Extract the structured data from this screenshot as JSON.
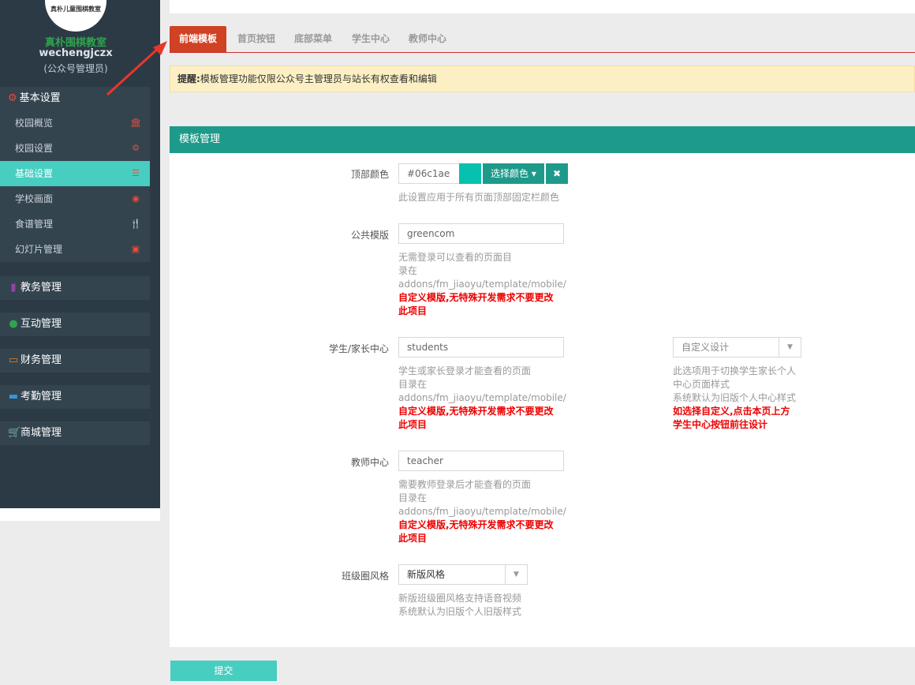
{
  "sidebar": {
    "logo_text": "真朴儿童围棋教室",
    "school_name": "真朴围棋教室",
    "user_name": "wechengjczx",
    "user_role": "(公众号管理员)",
    "basic_settings": {
      "title": "基本设置",
      "items": [
        {
          "label": "校园概览",
          "icon": "bank-icon"
        },
        {
          "label": "校园设置",
          "icon": "gear-icon"
        },
        {
          "label": "基础设置",
          "icon": "list-icon",
          "active": true
        },
        {
          "label": "学校画面",
          "icon": "eye-icon"
        },
        {
          "label": "食谱管理",
          "icon": "cutlery-icon"
        },
        {
          "label": "幻灯片管理",
          "icon": "picture-icon"
        }
      ]
    },
    "groups": [
      {
        "label": "教务管理",
        "icon": "book-icon",
        "color": "#8e44ad"
      },
      {
        "label": "互动管理",
        "icon": "wechat-icon",
        "color": "#2ea44f"
      },
      {
        "label": "财务管理",
        "icon": "money-icon",
        "color": "#e67e22"
      },
      {
        "label": "考勤管理",
        "icon": "card-icon",
        "color": "#3498db"
      },
      {
        "label": "商城管理",
        "icon": "cart-icon",
        "color": "#48cdc1"
      }
    ]
  },
  "tabs": [
    "前端模板",
    "首页按钮",
    "底部菜单",
    "学生中心",
    "教师中心"
  ],
  "notice": {
    "prefix": "提醒:",
    "text": "模板管理功能仅限公众号主管理员与站长有权查看和编辑"
  },
  "panel": {
    "title": "模板管理",
    "top_color": {
      "label": "顶部颜色",
      "value": "#06c1ae",
      "pick_label": "选择颜色",
      "clear_label": "✖",
      "help": "此设置应用于所有页面顶部固定栏颜色"
    },
    "public_template": {
      "label": "公共模版",
      "value": "greencom",
      "help_line1": "无需登录可以查看的页面目",
      "help_line2": "录在",
      "help_line3": "addons/fm_jiaoyu/template/mobile/",
      "warn_line1": "自定义模版,无特殊开发需求不要更改",
      "warn_line2": "此项目"
    },
    "student_center": {
      "label": "学生/家长中心",
      "value": "students",
      "help_line1": "学生或家长登录才能查看的页面",
      "help_line2": "目录在",
      "help_line3": "addons/fm_jiaoyu/template/mobile/",
      "warn_line1": "自定义模版,无特殊开发需求不要更改",
      "warn_line2": "此项目",
      "select_value": "自定义设计",
      "select_help_line1": "此选项用于切换学生家长个人",
      "select_help_line2": "中心页面样式",
      "select_help_line3": "系统默认为旧版个人中心样式",
      "select_warn_line1": "如选择自定义,点击本页上方",
      "select_warn_line2": "学生中心按钮前往设计"
    },
    "teacher_center": {
      "label": "教师中心",
      "value": "teacher",
      "help_line1": "需要教师登录后才能查看的页面",
      "help_line2": "目录在",
      "help_line3": "addons/fm_jiaoyu/template/mobile/",
      "warn_line1": "自定义模版,无特殊开发需求不要更改",
      "warn_line2": "此项目"
    },
    "class_style": {
      "label": "班级圈风格",
      "value": "新版风格",
      "help_line1": "新版班级圈风格支持语音视频",
      "help_line2": "系统默认为旧版个人旧版样式"
    }
  },
  "submit_label": "提交"
}
